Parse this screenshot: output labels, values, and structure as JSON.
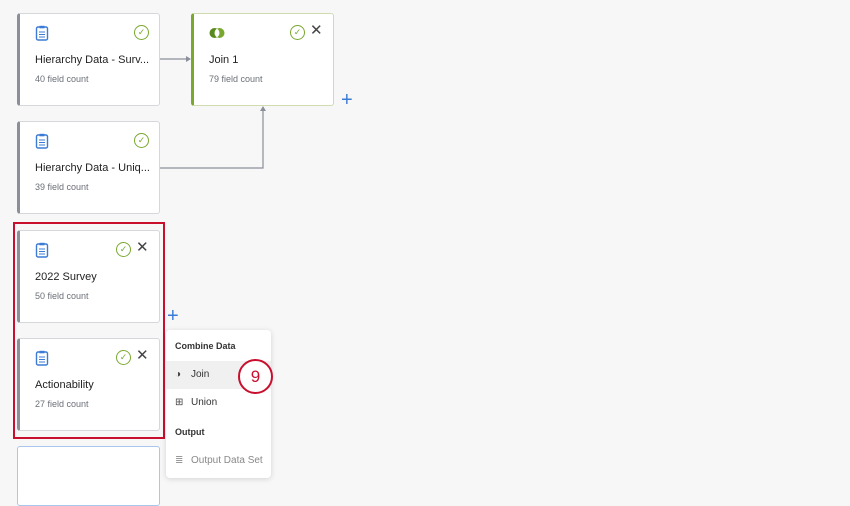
{
  "nodes": [
    {
      "title": "Hierarchy Data - Surv...",
      "count": "40 field count"
    },
    {
      "title": "Hierarchy Data - Uniq...",
      "count": "39 field count"
    },
    {
      "title": "2022 Survey",
      "count": "50 field count"
    },
    {
      "title": "Actionability",
      "count": "27 field count"
    }
  ],
  "join": {
    "title": "Join 1",
    "count": "79 field count"
  },
  "menu": {
    "section1": "Combine Data",
    "join": "Join",
    "union": "Union",
    "section2": "Output",
    "output": "Output Data Set"
  },
  "step_badge": "9",
  "colors": {
    "accent": "#7aa82f",
    "highlight": "#c8102e",
    "plus": "#3b7bd6"
  }
}
